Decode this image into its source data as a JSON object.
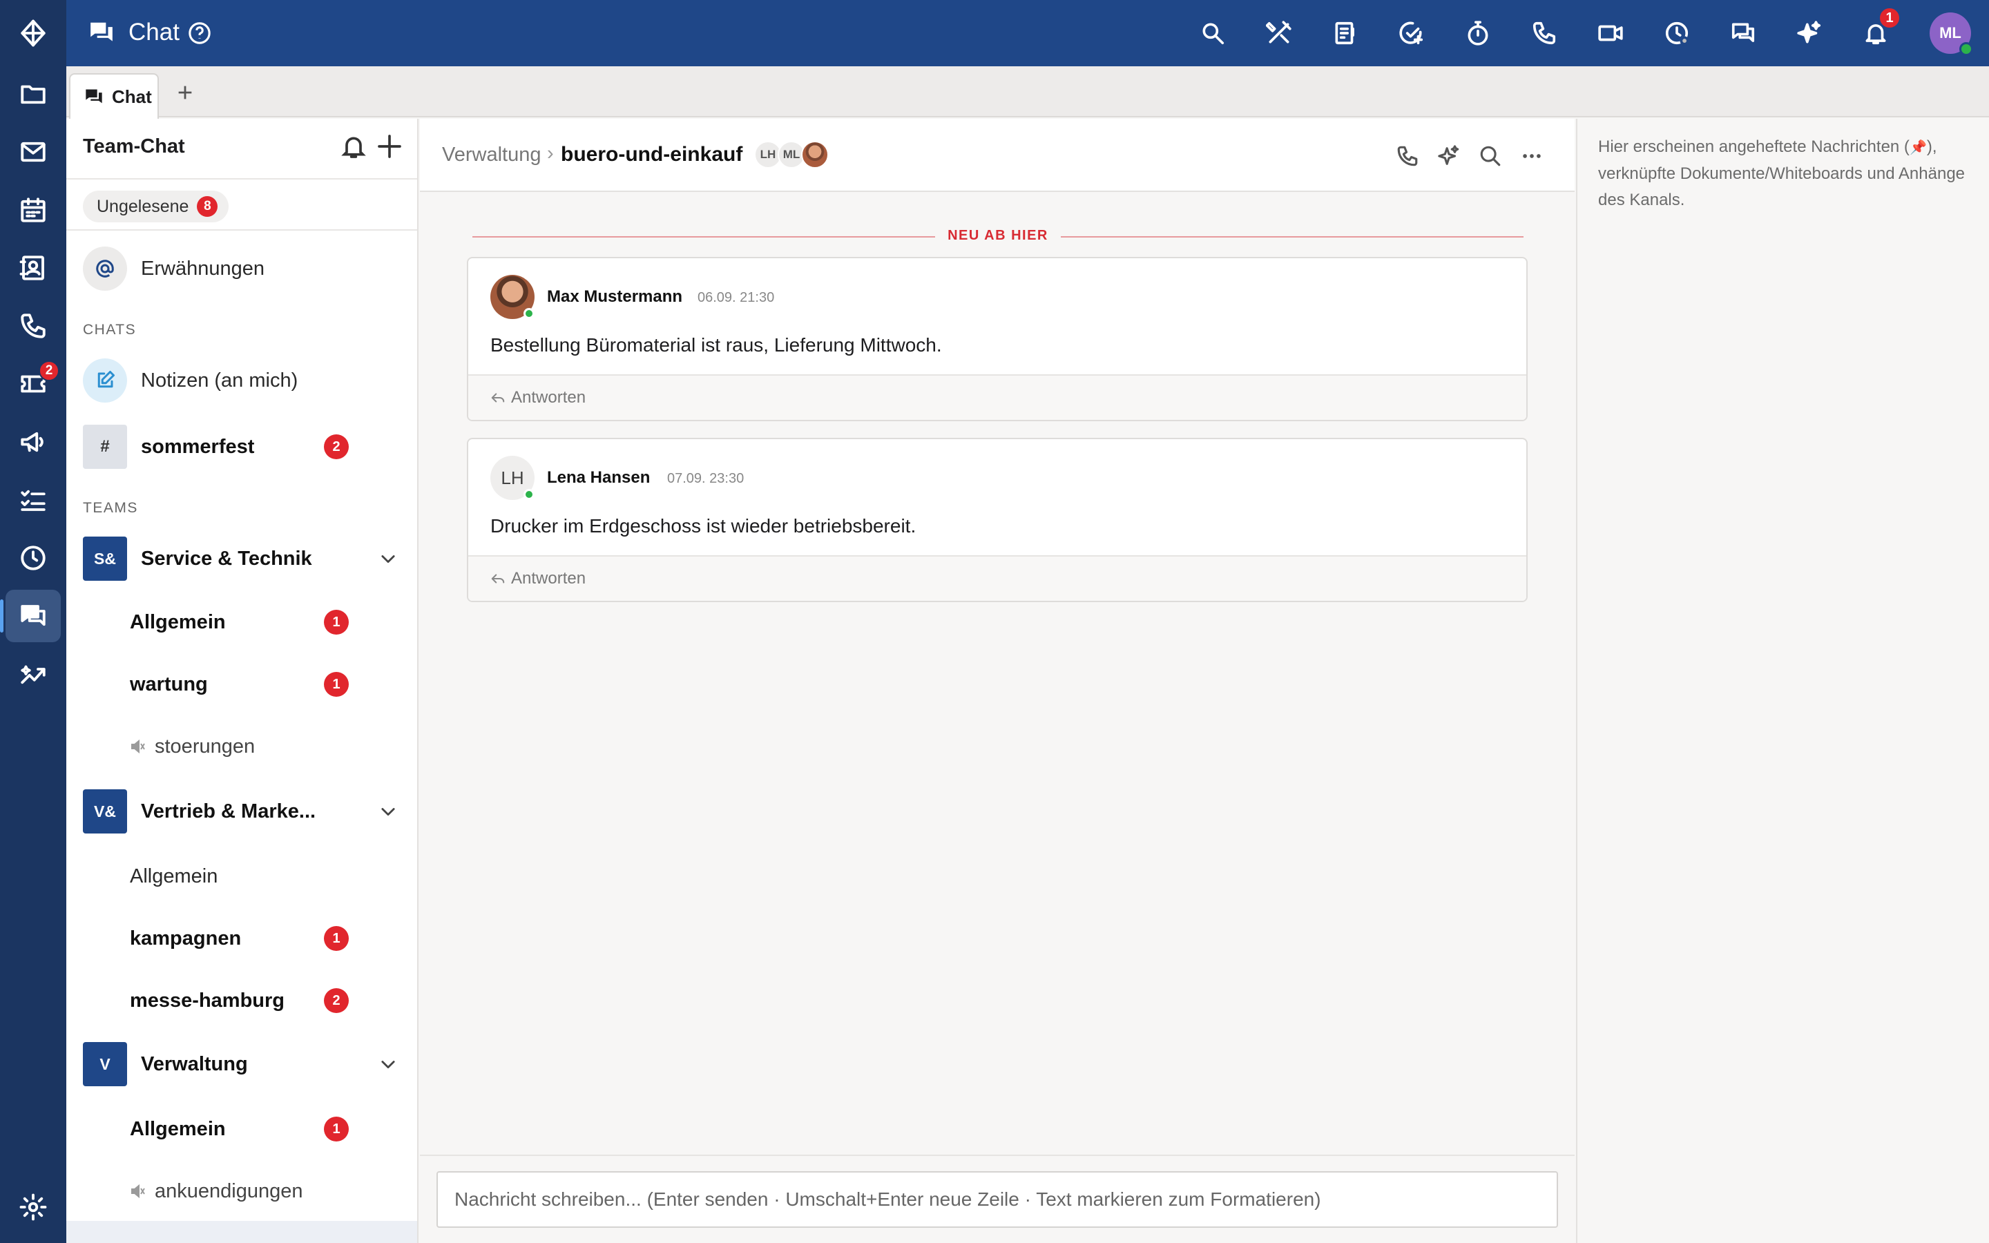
{
  "app": {
    "title": "Chat",
    "user_initials": "ML",
    "notification_count": "1"
  },
  "rail": {
    "items": [
      {
        "icon": "logo-icon"
      },
      {
        "icon": "folder-icon"
      },
      {
        "icon": "mail-icon"
      },
      {
        "icon": "calendar-icon"
      },
      {
        "icon": "contacts-icon"
      },
      {
        "icon": "phone-icon"
      },
      {
        "icon": "ticket-icon",
        "badge": "2"
      },
      {
        "icon": "megaphone-icon"
      },
      {
        "icon": "tasks-icon"
      },
      {
        "icon": "clock-icon"
      },
      {
        "icon": "chat-icon",
        "active": true
      },
      {
        "icon": "analytics-icon"
      },
      {
        "icon": "settings-icon"
      }
    ]
  },
  "toolbar": {
    "icons": [
      "search-icon",
      "tools-icon",
      "note-icon",
      "task-add-icon",
      "timer-icon",
      "phone-icon",
      "video-icon",
      "time-tracking-icon",
      "chat-icon",
      "ai-sparkle-icon",
      "bell-icon"
    ]
  },
  "tabs": [
    {
      "label": "Chat",
      "active": true
    }
  ],
  "sidebar": {
    "title": "Team-Chat",
    "unread_label": "Ungelesene",
    "unread_count": "8",
    "mentions_label": "Erwähnungen",
    "chats_section": "CHATS",
    "notes_label": "Notizen (an mich)",
    "channel_hash": "#",
    "sommerfest_label": "sommerfest",
    "sommerfest_badge": "2",
    "teams_section": "TEAMS",
    "teams": [
      {
        "abbr": "S&",
        "name": "Service & Technik",
        "channels": [
          {
            "name": "Allgemein",
            "badge": "1",
            "bold": true
          },
          {
            "name": "wartung",
            "badge": "1",
            "bold": true
          },
          {
            "name": "stoerungen",
            "muted": true
          }
        ]
      },
      {
        "abbr": "V&",
        "name": "Vertrieb & Marke...",
        "channels": [
          {
            "name": "Allgemein"
          },
          {
            "name": "kampagnen",
            "badge": "1",
            "bold": true
          },
          {
            "name": "messe-hamburg",
            "badge": "2",
            "bold": true
          }
        ]
      },
      {
        "abbr": "V",
        "name": "Verwaltung",
        "channels": [
          {
            "name": "Allgemein",
            "badge": "1",
            "bold": true
          },
          {
            "name": "ankuendigungen",
            "muted": true
          }
        ]
      }
    ]
  },
  "channel": {
    "breadcrumb_parent": "Verwaltung",
    "breadcrumb_sep": "›",
    "breadcrumb_current": "buero-und-einkauf",
    "members": [
      "LH",
      "ML"
    ],
    "new_divider": "NEU AB HIER",
    "messages": [
      {
        "author": "Max Mustermann",
        "time": "06.09. 21:30",
        "text": "Bestellung Büromaterial ist raus, Lieferung Mittwoch.",
        "reply_label": "Antworten"
      },
      {
        "author": "Lena Hansen",
        "initials": "LH",
        "time": "07.09. 23:30",
        "text": "Drucker im Erdgeschoss ist wieder betriebsbereit.",
        "reply_label": "Antworten"
      }
    ],
    "composer_placeholder": "Nachricht schreiben... (Enter senden · Umschalt+Enter neue Zeile · Text markieren zum Formatieren)"
  },
  "pinned_panel": {
    "text_before_pin": "Hier erscheinen angeheftete Nachrichten (",
    "pin_glyph": "📌",
    "text_after_pin": "), verknüpfte Dokumente/Whiteboards und Anhänge des Kanals."
  },
  "colors": {
    "rail_bg": "#1b3561",
    "topbar_bg": "#1f4788",
    "badge_red": "#e1262d",
    "team_square": "#1f4788",
    "new_divider": "#d82b33"
  }
}
